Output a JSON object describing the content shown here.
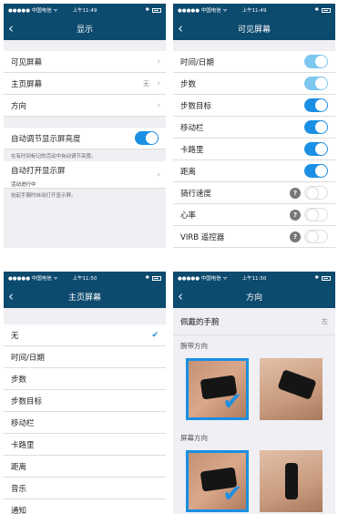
{
  "status": {
    "carrier": "●●●●● 中国电信 ᯤ",
    "time1": "上午11:49",
    "time2": "上午11:50"
  },
  "screen1": {
    "title": "显示",
    "rows": [
      {
        "label": "可见屏幕",
        "value": ""
      },
      {
        "label": "主页屏幕",
        "value": "无"
      },
      {
        "label": "方向",
        "value": ""
      }
    ],
    "auto_brightness": {
      "label": "自动调节显示屏亮度",
      "note": "在有时间标记的活动中自动调节亮度。"
    },
    "auto_on": {
      "label": "自动打开显示屏",
      "sub": "活动进行中",
      "note": "抬起手腕时自动打开显示屏。"
    }
  },
  "screen2": {
    "title": "可见屏幕",
    "rows": [
      {
        "label": "时间/日期",
        "state": "locked"
      },
      {
        "label": "步数",
        "state": "locked"
      },
      {
        "label": "步数目标",
        "state": "on"
      },
      {
        "label": "移动栏",
        "state": "on"
      },
      {
        "label": "卡路里",
        "state": "on"
      },
      {
        "label": "距离",
        "state": "on"
      },
      {
        "label": "骑行速度",
        "state": "off",
        "help": "?"
      },
      {
        "label": "心率",
        "state": "off",
        "help": "?"
      },
      {
        "label": "VIRB 遥控器",
        "state": "off",
        "help": "?"
      }
    ]
  },
  "screen3": {
    "title": "主页屏幕",
    "items": [
      "无",
      "时间/日期",
      "步数",
      "步数目标",
      "移动栏",
      "卡路里",
      "距离",
      "音乐",
      "通知"
    ],
    "selected": "无"
  },
  "screen4": {
    "title": "方向",
    "wrist_label": "佩戴的手腕",
    "wrist_value": "左",
    "band_title": "腕带方向",
    "screen_title": "屏幕方向"
  },
  "colors": {
    "nav": "#0c4a6e",
    "accent": "#1b8fe3",
    "accent_light": "#7cc6f0"
  }
}
